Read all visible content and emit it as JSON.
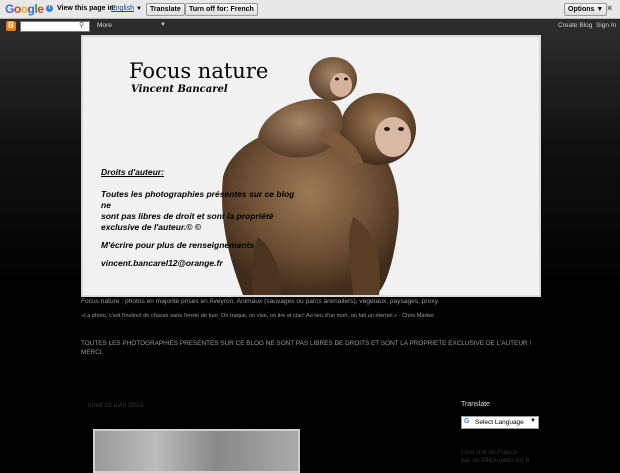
{
  "translate_bar": {
    "logo": "Google",
    "prompt": "View this page in:",
    "language": "English",
    "translate_label": "Translate",
    "turn_off_label": "Turn off for: French",
    "options_label": "Options ▼",
    "close": "×"
  },
  "navbar": {
    "more_label": "More",
    "create_blog": "Create Blog",
    "sign_in": "Sign In"
  },
  "banner": {
    "title": "Focus nature",
    "author": "Vincent Bancarel",
    "rights_heading": "Droits d'auteur:",
    "rights_lines": [
      "Toutes les photographies présentes sur ce blog ne",
      "sont pas libres de droit et sont la propriété",
      "exclusive de l'auteur.© ©"
    ],
    "contact": "M'écrire pour plus de renseignements",
    "email": "vincent.bancarel12@orange.fr"
  },
  "description": {
    "line1": "Focus nature : photos en majorité prises en Aveyron. Animaux (sauvages ou parcs animaliers), végétaux, paysages, proxy.",
    "quote": "«La photo, c'est l'instinct de chasse sans l'envie de tuer. On traque, on vise, on tire et clac! Au lieu d'un mort, on fait un éternel.» - Chris Marker.",
    "notice": "TOUTES LES PHOTOGRAPHIES PRESENTES SUR CE BLOG NE SONT PAS LIBRES DE DROITS ET SONT LA PROPRIETE EXCLUSIVE DE L'AUTEUR ! MERCI."
  },
  "post": {
    "date": "lundi 15 avril 2013"
  },
  "sidebar": {
    "translate_title": "Translate",
    "select_language": "Select Language",
    "link_line1": "Liste d'oi de France",
    "link_line2": "par un Afficionado sur 8"
  },
  "colors": {
    "background": "#000000",
    "banner_bg": "#f1f1f1",
    "monkey_fur": "#7a5a3a"
  }
}
